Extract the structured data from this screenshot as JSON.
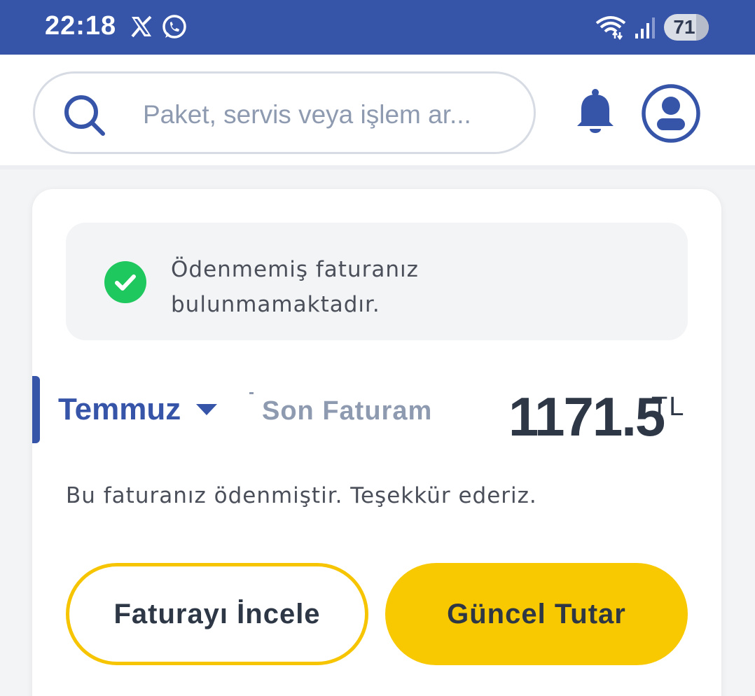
{
  "status_bar": {
    "time": "22:18",
    "app_icons": [
      "x-icon",
      "whatsapp-icon"
    ],
    "right_icons": [
      "wifi-icon",
      "signal-icon"
    ],
    "battery": "71"
  },
  "header": {
    "search": {
      "placeholder": "Paket, servis veya işlem ar..."
    },
    "icons": [
      "search-icon",
      "bell-icon",
      "profile-icon"
    ]
  },
  "bill_card": {
    "notice": {
      "icon": "check-circle-icon",
      "text": "Ödenmemiş faturanız bulunmamaktadır."
    },
    "month": "Temmuz",
    "bill_label": "Son Faturam",
    "amount": "1171.5",
    "currency": "TL",
    "paid_message": "Bu faturanız ödenmiştir. Teşekkür ederiz.",
    "buttons": {
      "review": "Faturayı İncele",
      "current_amount": "Güncel Tutar"
    }
  },
  "colors": {
    "brand_blue": "#3654a8",
    "accent_yellow": "#f8c800",
    "success_green": "#1fc85e",
    "text_dark": "#2d3746",
    "text_muted": "#8e9ab0"
  }
}
